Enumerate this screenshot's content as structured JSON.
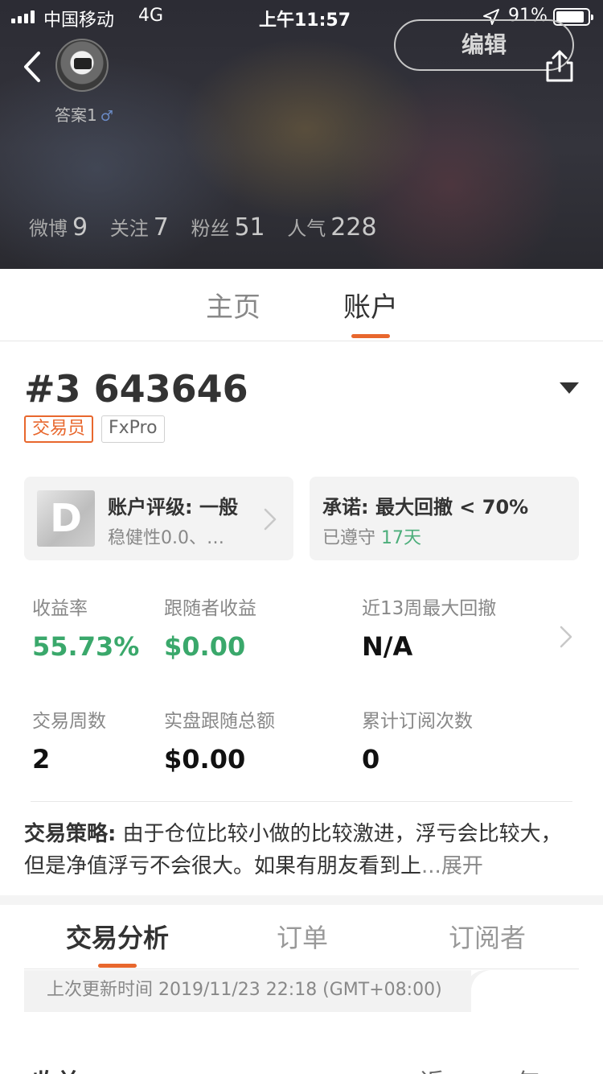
{
  "status_bar": {
    "carrier": "中国移动",
    "network": "4G",
    "time": "上午11:57",
    "battery": "91%"
  },
  "profile": {
    "username": "答案1",
    "gender_symbol": "♂",
    "edit_label": "编辑",
    "stats": [
      {
        "label": "微博",
        "value": "9"
      },
      {
        "label": "关注",
        "value": "7"
      },
      {
        "label": "粉丝",
        "value": "51"
      },
      {
        "label": "人气",
        "value": "228"
      }
    ]
  },
  "main_tabs": [
    {
      "label": "主页",
      "active": false
    },
    {
      "label": "账户",
      "active": true
    }
  ],
  "account": {
    "id": "#3 643646",
    "tags": [
      "交易员",
      "FxPro"
    ],
    "rating_card": {
      "grade": "D",
      "title": "账户评级: 一般",
      "subtitle": "稳健性0.0、…"
    },
    "promise_card": {
      "title": "承诺: 最大回撤 < 70%",
      "subtitle_prefix": "已遵守",
      "days": "17天"
    },
    "metrics": [
      {
        "label": "收益率",
        "value": "55.73%",
        "color": "#3aa86b"
      },
      {
        "label": "跟随者收益",
        "value": "$0.00",
        "color": "#3aa86b"
      },
      {
        "label": "近13周最大回撤",
        "value": "N/A",
        "color": "#111111"
      },
      {
        "label": "交易周数",
        "value": "2",
        "color": "#111111"
      },
      {
        "label": "实盘跟随总额",
        "value": "$0.00",
        "color": "#111111"
      },
      {
        "label": "累计订阅次数",
        "value": "0",
        "color": "#111111"
      }
    ],
    "strategy": {
      "label": "交易策略:",
      "text": " 由于仓位比较小做的比较激进，浮亏会比较大，但是净值浮亏不会很大。如果有朋友看到上",
      "ellipsis": "...",
      "expand": "展开"
    }
  },
  "sub_tabs": [
    {
      "label": "交易分析",
      "active": true
    },
    {
      "label": "订单",
      "active": false
    },
    {
      "label": "订阅者",
      "active": false
    }
  ],
  "update_time": "上次更新时间 2019/11/23 22:18 (GMT+08:00)",
  "bottom_partial": {
    "left": "收益",
    "right": "近一年"
  },
  "colors": {
    "accent": "#e8672d",
    "positive": "#3aa86b"
  }
}
